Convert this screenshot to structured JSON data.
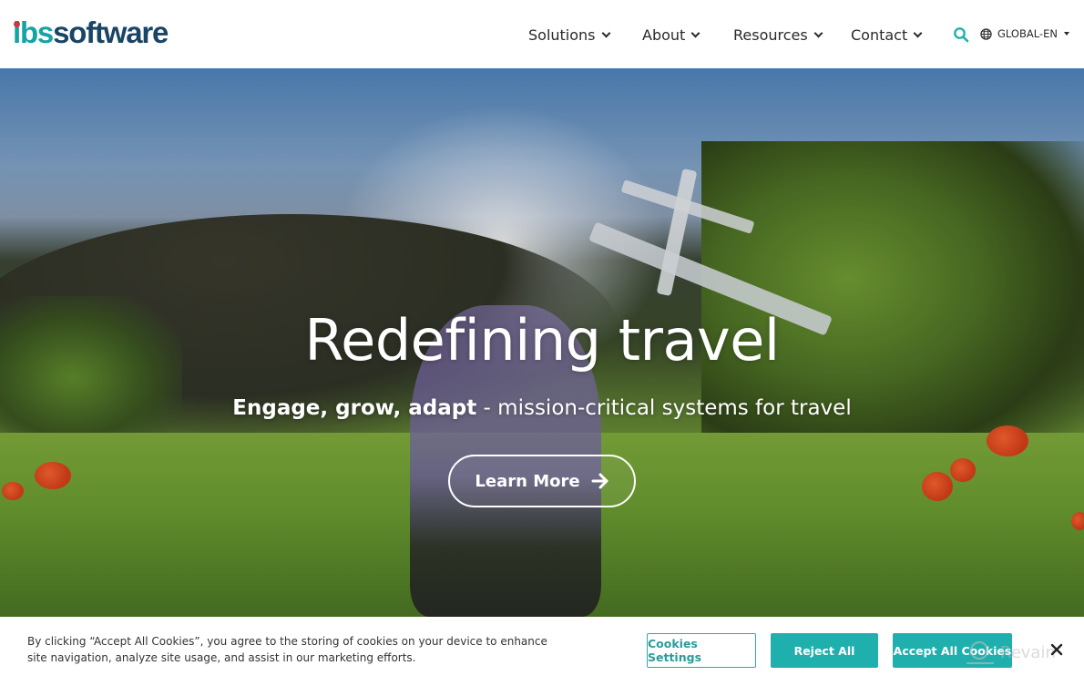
{
  "header": {
    "logo": {
      "part1": "ibs",
      "part2": "software"
    },
    "nav": [
      {
        "label": "Solutions"
      },
      {
        "label": "About"
      },
      {
        "label": "Resources"
      },
      {
        "label": "Contact"
      }
    ],
    "search_icon": "search-icon",
    "language": {
      "label": "GLOBAL-EN",
      "icon": "globe-icon"
    }
  },
  "hero": {
    "title": "Redefining travel",
    "subtitle_bold": "Engage, grow, adapt",
    "subtitle_rest": " - mission-critical systems for travel",
    "cta_label": "Learn More",
    "cta_icon": "arrow-right-icon"
  },
  "cookie_banner": {
    "text": "By clicking “Accept All Cookies”, you agree to the storing of cookies on your device to enhance site navigation, analyze site usage, and assist in our marketing efforts.",
    "settings_label": "Cookies Settings",
    "reject_label": "Reject All",
    "accept_label": "Accept All Cookies",
    "close_icon": "close-icon"
  },
  "watermark": {
    "text": "Revain"
  },
  "colors": {
    "brand_teal": "#15a3a6",
    "brand_navy": "#1a4565",
    "logo_dot": "#c8383f",
    "button_teal": "#1fb0ae",
    "search_icon": "#1fb0ae"
  }
}
